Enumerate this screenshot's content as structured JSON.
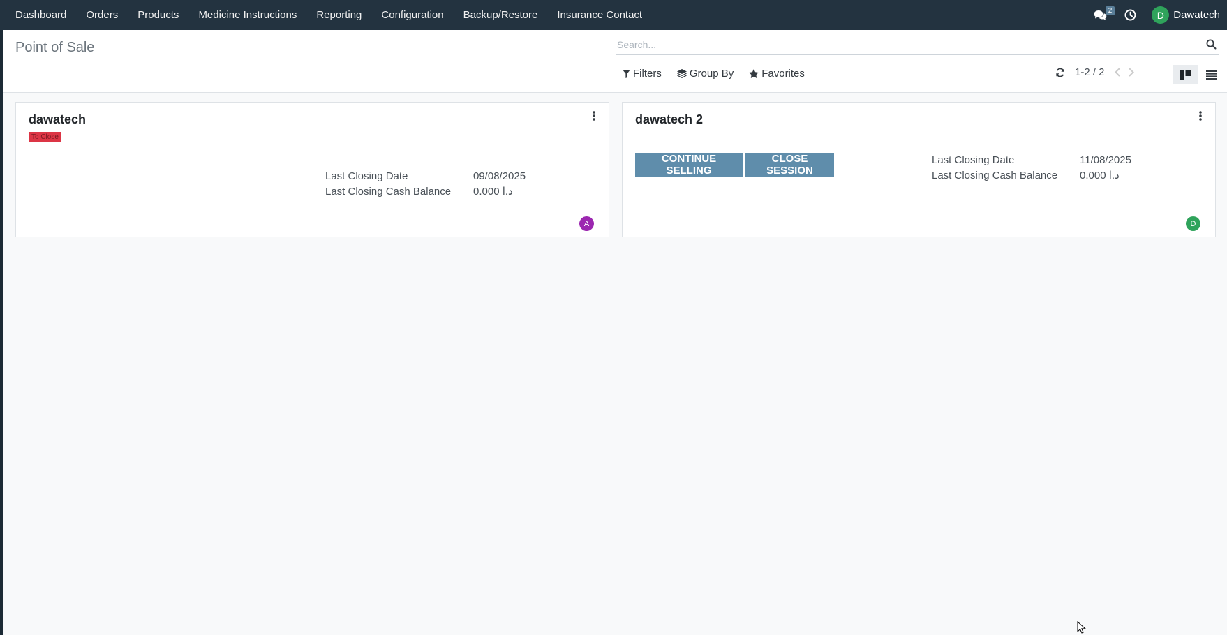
{
  "nav": {
    "menu": [
      "Dashboard",
      "Orders",
      "Products",
      "Medicine Instructions",
      "Reporting",
      "Configuration",
      "Backup/Restore",
      "Insurance Contact"
    ],
    "messages_badge": "2",
    "user_initial": "D",
    "user_name": "Dawatech"
  },
  "control": {
    "title": "Point of Sale",
    "search_placeholder": "Search...",
    "filters_label": "Filters",
    "groupby_label": "Group By",
    "favorites_label": "Favorites",
    "pager": "1-2 / 2"
  },
  "cards": [
    {
      "name": "dawatech",
      "status": "To Close",
      "last_closing_date_label": "Last Closing Date",
      "last_closing_date": "09/08/2025",
      "cash_balance_label": "Last Closing Cash Balance",
      "cash_balance": "0.000  د.ا",
      "avatar_initial": "A",
      "avatar_color": "#9c27b0"
    },
    {
      "name": "dawatech 2",
      "continue_label": "CONTINUE SELLING",
      "close_label": "CLOSE SESSION",
      "last_closing_date_label": "Last Closing Date",
      "last_closing_date": "11/08/2025",
      "cash_balance_label": "Last Closing Cash Balance",
      "cash_balance": "0.000  د.ا",
      "avatar_initial": "D",
      "avatar_color": "#2fa35b"
    }
  ]
}
